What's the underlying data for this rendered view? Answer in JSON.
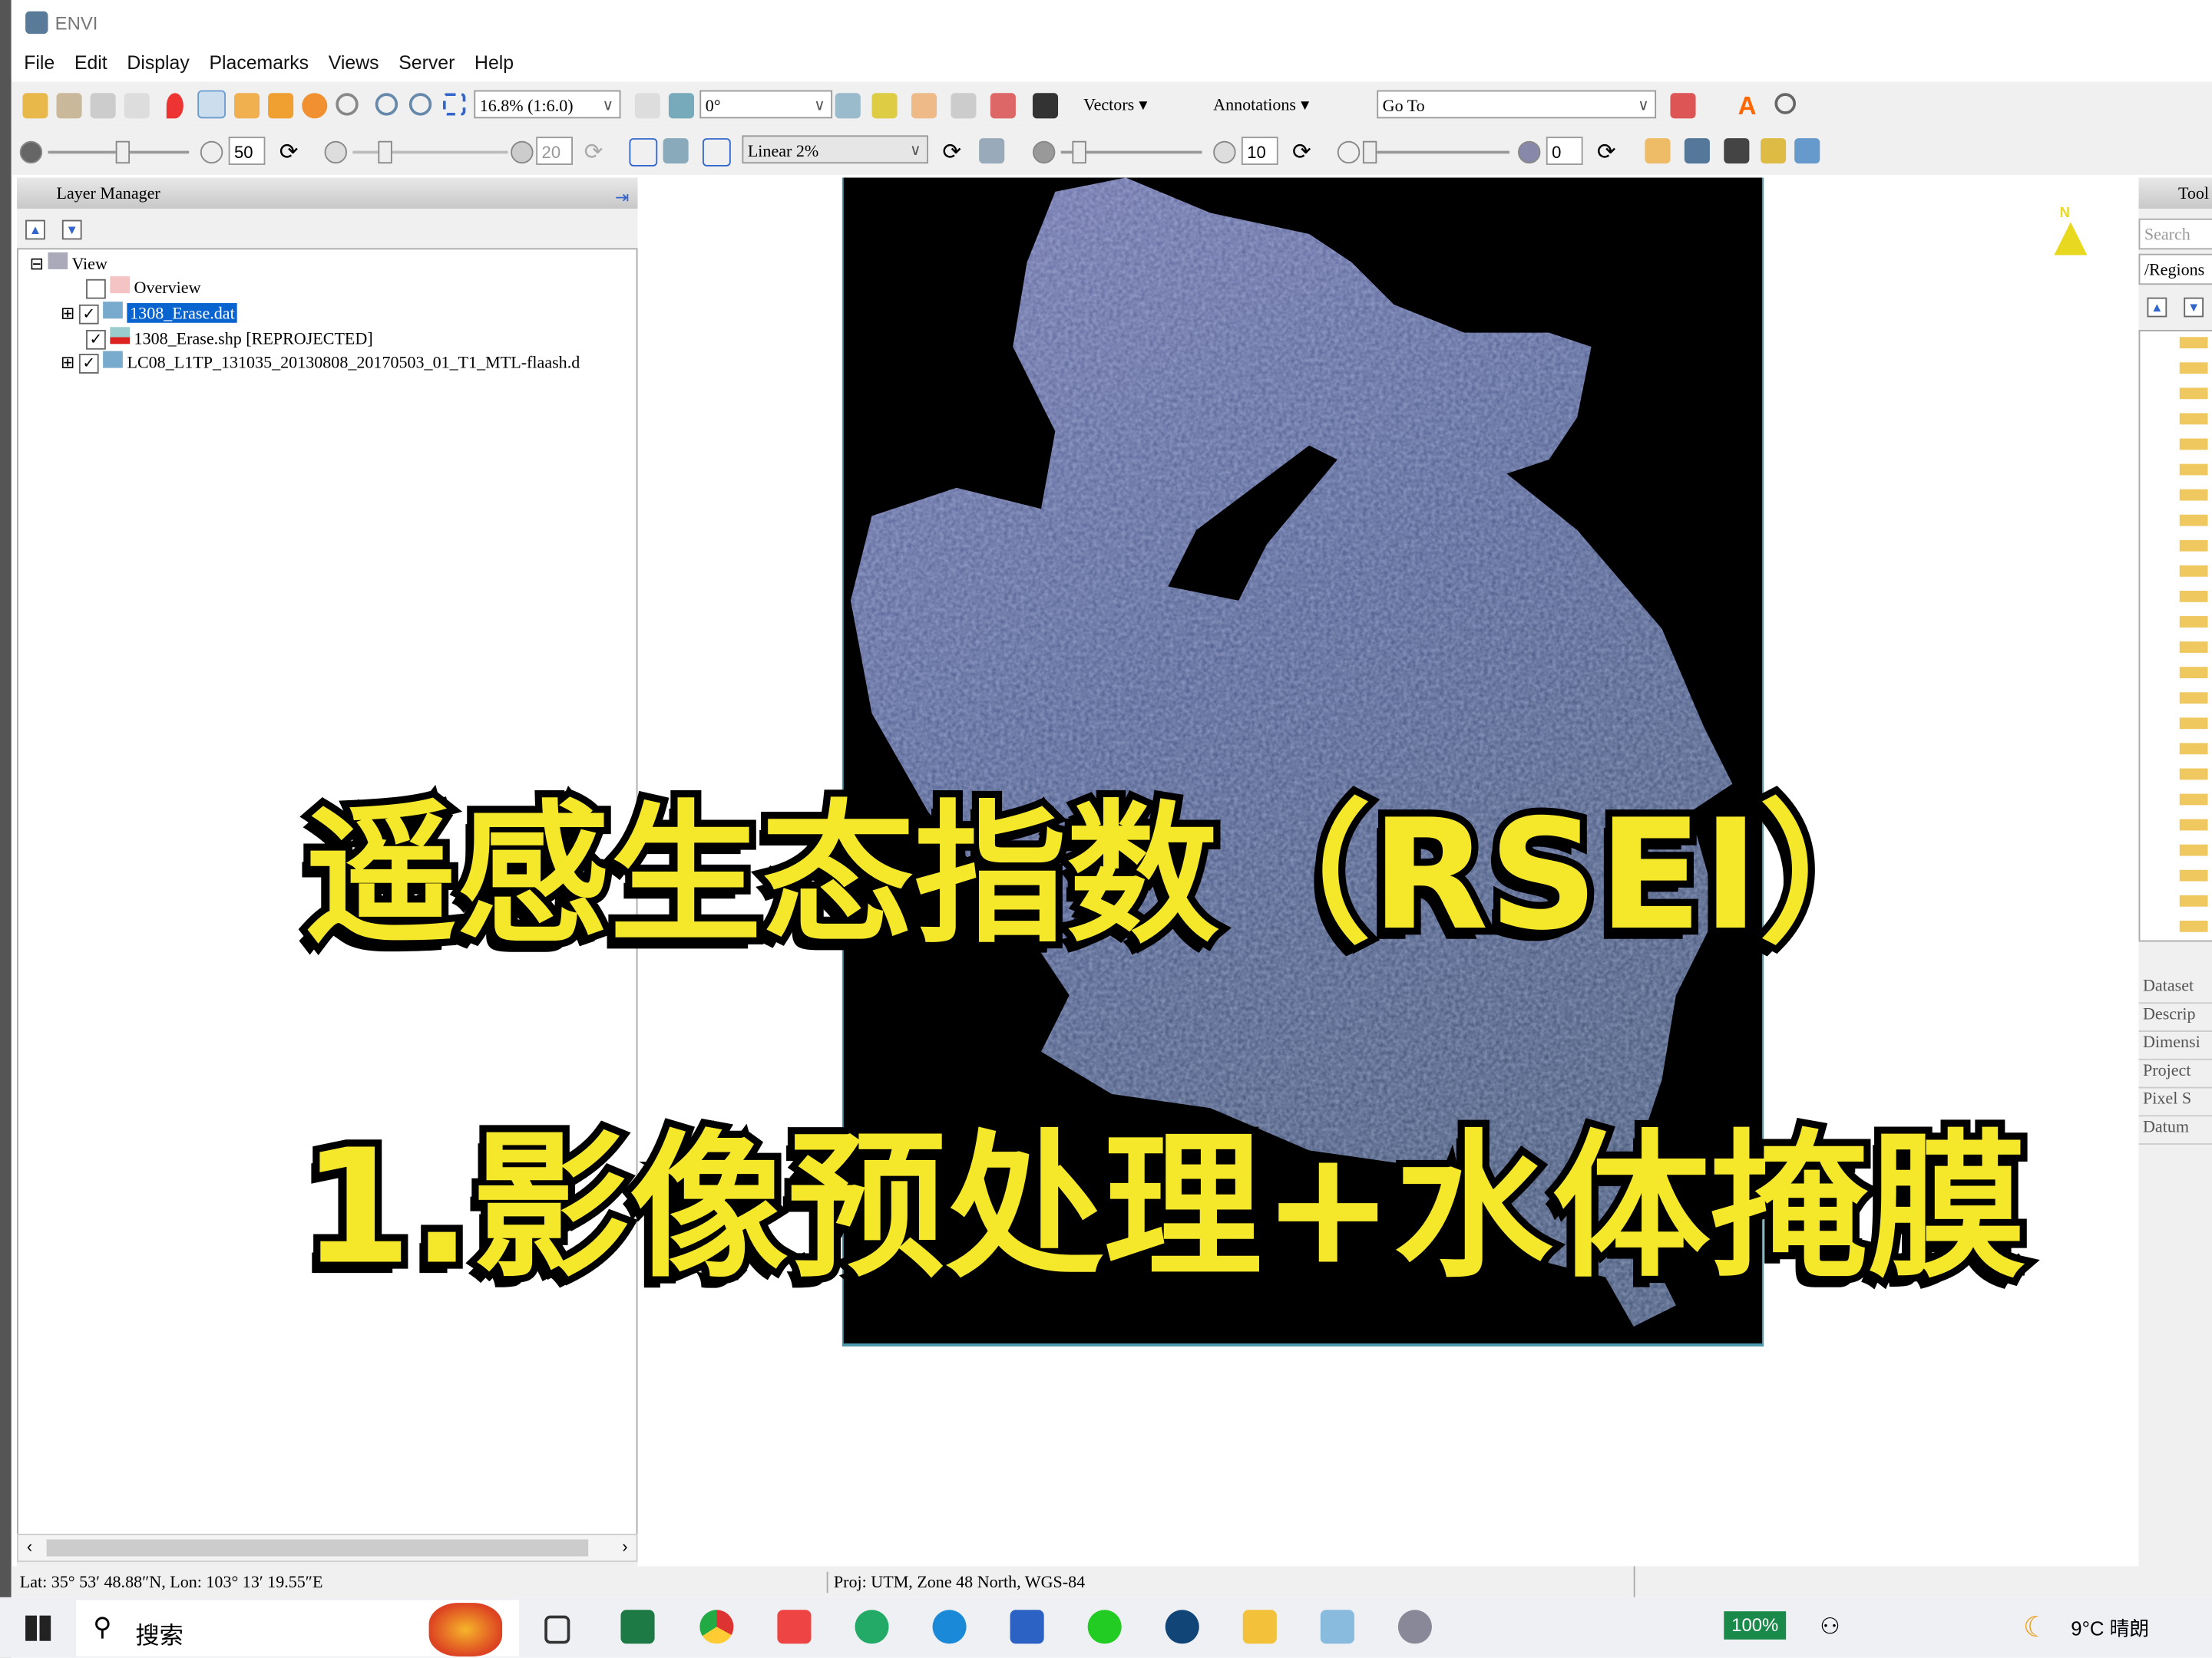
{
  "app": {
    "title": "ENVI"
  },
  "menu": [
    "File",
    "Edit",
    "Display",
    "Placemarks",
    "Views",
    "Server",
    "Help"
  ],
  "toolbar": {
    "zoom": "16.8% (1:6.0)",
    "rotation": "0°",
    "vectors": "Vectors",
    "annotations": "Annotations",
    "goto": "Go To",
    "brightness": "50",
    "contrast": "20",
    "stretch": "Linear 2%",
    "sharpen": "10",
    "transparency": "0"
  },
  "layer_manager": {
    "title": "Layer Manager",
    "root": "View",
    "items": [
      {
        "label": "Overview",
        "checked": false
      },
      {
        "label": "1308_Erase.dat",
        "checked": true,
        "selected": true
      },
      {
        "label": "1308_Erase.shp [REPROJECTED]",
        "checked": true
      },
      {
        "label": "LC08_L1TP_131035_20130808_20170503_01_T1_MTL-flaash.d",
        "checked": true
      }
    ]
  },
  "toolbox": {
    "title": "Tool",
    "search": "Search",
    "path": "/Regions",
    "props": [
      "Dataset",
      "Descrip",
      "Dimensi",
      "Project",
      "Pixel S",
      "Datum"
    ]
  },
  "overlay": {
    "line1": "遥感生态指数（RSEI）",
    "line2": "1.影像预处理+水体掩膜"
  },
  "north": "N",
  "status": {
    "coords": "Lat: 35° 53′ 48.88″N, Lon: 103° 13′ 19.55″E",
    "proj": "Proj: UTM, Zone 48 North, WGS-84"
  },
  "taskbar": {
    "search": "搜索",
    "battery": "100%",
    "weather": "9°C 晴朗"
  }
}
